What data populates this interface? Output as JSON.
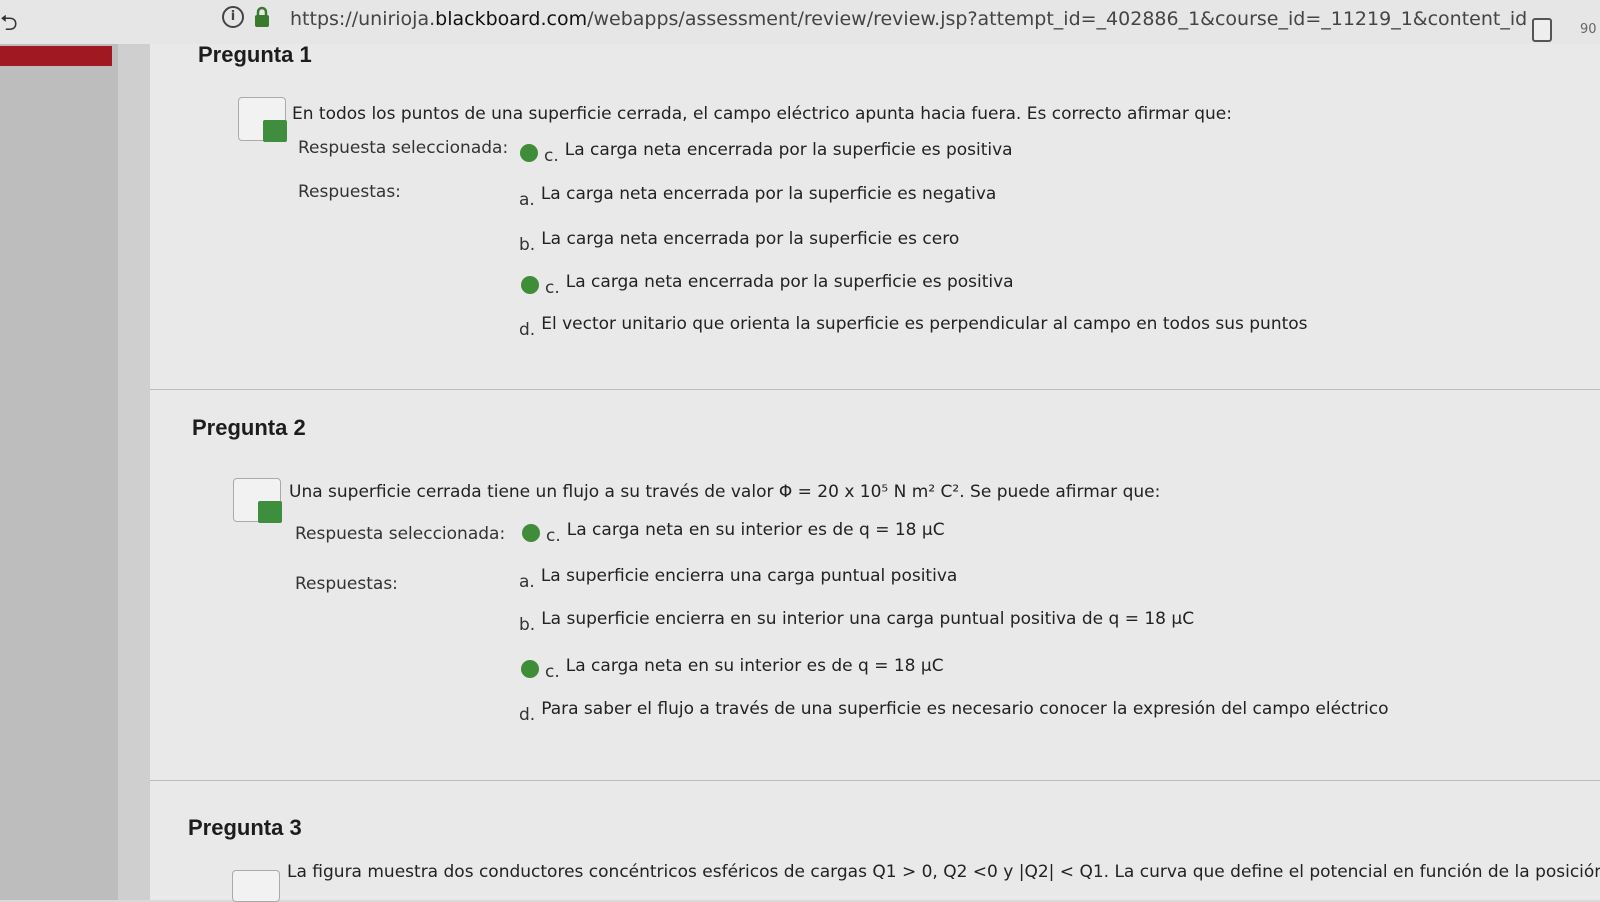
{
  "browser": {
    "url_prefix": "https://unirioja.",
    "url_host": "blackboard.com",
    "url_path": "/webapps/assessment/review/review.jsp?attempt_id=_402886_1&course_id=_11219_1&content_id",
    "zoom": "90"
  },
  "labels": {
    "selected": "Respuesta seleccionada:",
    "answers": "Respuestas:"
  },
  "questions": [
    {
      "title": "Pregunta 1",
      "text": "En todos los puntos de una superficie cerrada, el campo eléctrico apunta hacia fuera. Es correcto afirmar que:",
      "selected_letter": "c.",
      "selected_text": "La carga neta encerrada por la superficie es positiva",
      "answers": [
        {
          "letter": "a.",
          "text": "La carga neta encerrada por la superficie es negativa",
          "correct": false
        },
        {
          "letter": "b.",
          "text": "La carga neta encerrada por la superficie es cero",
          "correct": false
        },
        {
          "letter": "c.",
          "text": "La carga neta encerrada por la superficie es positiva",
          "correct": true
        },
        {
          "letter": "d.",
          "text": "El vector unitario que orienta la superficie es perpendicular al campo en todos sus puntos",
          "correct": false
        }
      ]
    },
    {
      "title": "Pregunta 2",
      "text": "Una superficie cerrada tiene un flujo a su través de valor Φ = 20 x 10⁵ N m² C². Se puede afirmar que:",
      "selected_letter": "c.",
      "selected_text": "La carga neta en su interior es de q = 18 μC",
      "answers": [
        {
          "letter": "a.",
          "text": "La superficie encierra una carga puntual positiva",
          "correct": false
        },
        {
          "letter": "b.",
          "text": "La superficie encierra en su interior una carga puntual positiva de q = 18 μC",
          "correct": false
        },
        {
          "letter": "c.",
          "text": "La carga neta en su interior es de q = 18 μC",
          "correct": true
        },
        {
          "letter": "d.",
          "text": "Para saber el flujo a través de una superficie es necesario conocer la expresión del campo eléctrico",
          "correct": false
        }
      ]
    },
    {
      "title": "Pregunta 3",
      "text": "La figura muestra dos conductores concéntricos esféricos de cargas Q1 > 0, Q2 <0 y |Q2| < Q1. La curva que define el potencial en función de la posición es:"
    }
  ],
  "colors": {
    "accent_red": "#a01820",
    "correct_green": "#3f8d38"
  },
  "icons": {
    "correct": "check-circle-icon",
    "status": "graded-check-icon",
    "lock": "lock-icon",
    "info": "info-icon"
  }
}
